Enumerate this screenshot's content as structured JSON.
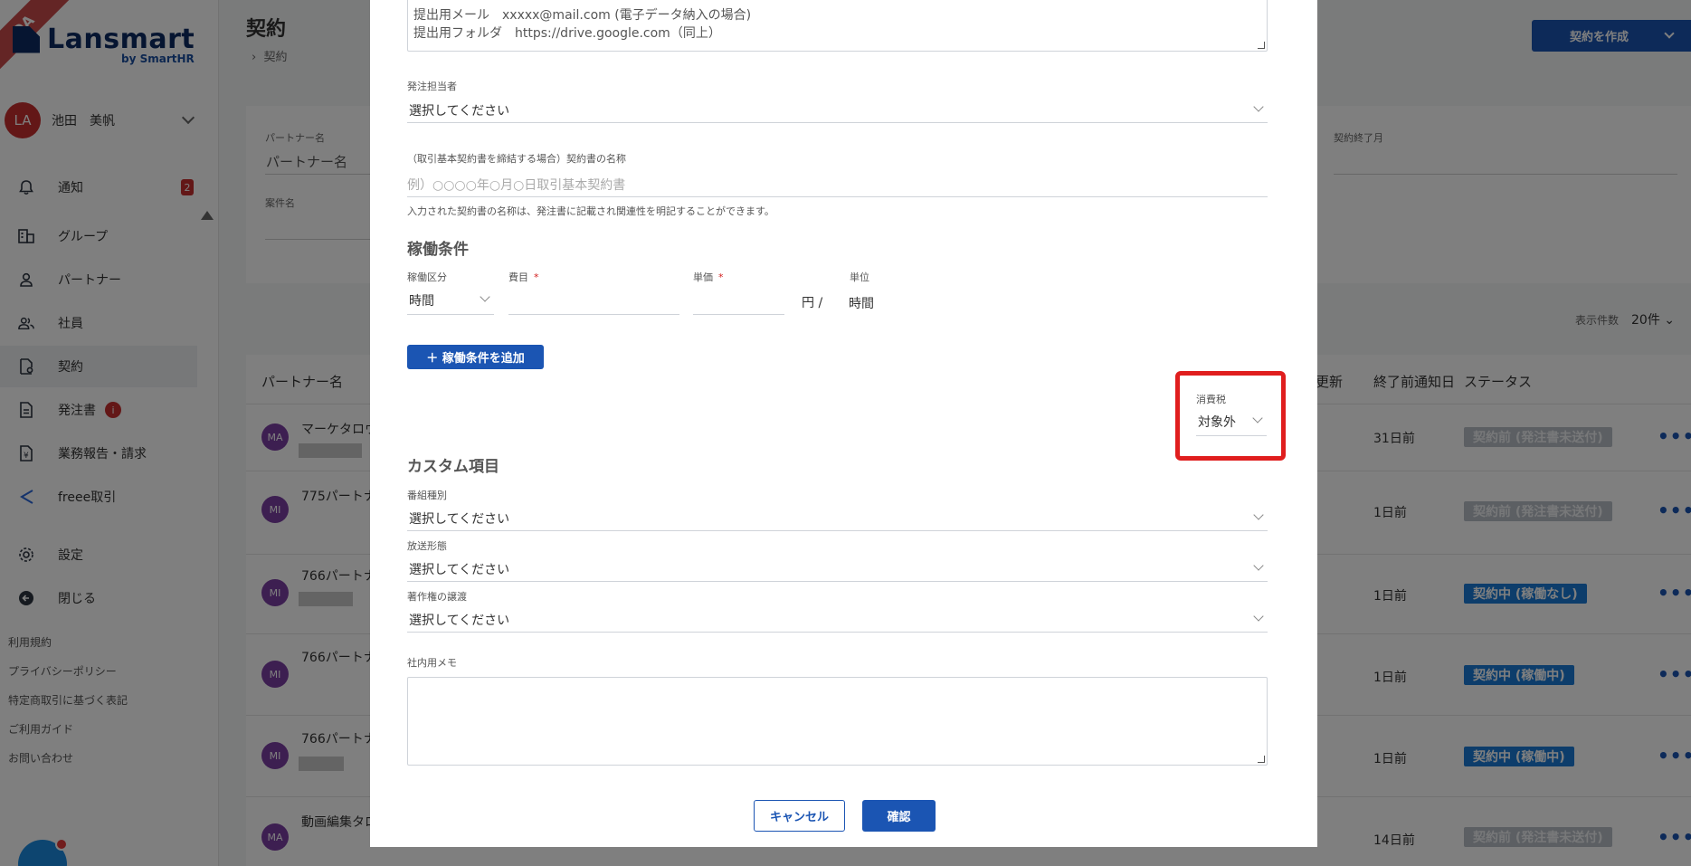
{
  "app": {
    "ribbon": "QA",
    "logo_text": "Lansmart",
    "logo_sub": "by SmartHR"
  },
  "user": {
    "initials": "LA",
    "name": "池田　美帆"
  },
  "nav": [
    {
      "label": "通知",
      "icon": "bell-icon",
      "badge": "2"
    },
    {
      "label": "グループ",
      "icon": "building-icon"
    },
    {
      "label": "パートナー",
      "icon": "person-icon"
    },
    {
      "label": "社員",
      "icon": "people-icon"
    },
    {
      "label": "契約",
      "icon": "contract-icon"
    },
    {
      "label": "発注書",
      "icon": "document-icon",
      "badge": "i"
    },
    {
      "label": "業務報告・請求",
      "icon": "invoice-icon"
    },
    {
      "label": "freee取引",
      "icon": "freee-icon"
    },
    {
      "label": "設定",
      "icon": "gear-icon"
    },
    {
      "label": "閉じる",
      "icon": "arrow-left-icon"
    }
  ],
  "footer_links": [
    "利用規約",
    "プライバシーポリシー",
    "特定商取引に基づく表記",
    "ご利用ガイド",
    "お問い合わせ"
  ],
  "page": {
    "title": "契約",
    "breadcrumb": "契約",
    "create_button": "契約を作成",
    "filters": {
      "partner_label": "パートナー名",
      "partner_placeholder": "パートナー名",
      "case_label": "案件名",
      "end_month_label": "契約終了月"
    },
    "per_page_label": "表示件数",
    "per_page_value": "20件",
    "table": {
      "headers": {
        "partner": "パートナー名",
        "renewal": "更新",
        "notice": "終了前通知日",
        "status": "ステータス"
      },
      "rows": [
        {
          "avatar": "MA",
          "name": "マーケタロウ",
          "days": "31日前",
          "status": "契約前 (発注書未送付)",
          "status_type": "grey"
        },
        {
          "avatar": "MI",
          "name": "775パートナ",
          "days": "1日前",
          "status": "契約前 (発注書未送付)",
          "status_type": "grey"
        },
        {
          "avatar": "MI",
          "name": "766パートナ",
          "days": "1日前",
          "status": "契約中 (稼働なし)",
          "status_type": "blue"
        },
        {
          "avatar": "MI",
          "name": "766パートナ",
          "days": "1日前",
          "status": "契約中 (稼働中)",
          "status_type": "blue"
        },
        {
          "avatar": "MI",
          "name": "766パートナ",
          "days": "1日前",
          "status": "契約中 (稼働中)",
          "status_type": "blue"
        },
        {
          "avatar": "MA",
          "name": "動画編集タロ",
          "days": "14日前",
          "status": "契約前 (発注書未送付)",
          "status_type": "grey"
        }
      ]
    }
  },
  "modal": {
    "top_textarea_lines": [
      "提出用メール　xxxxx@mail.com (電子データ納入の場合)",
      "提出用フォルダ　https://drive.google.com（同上）"
    ],
    "order_manager": {
      "label": "発注担当者",
      "value": "選択してください"
    },
    "contract_name": {
      "label": "（取引基本契約書を締結する場合）契約書の名称",
      "placeholder": "例）○○○○年○月○日取引基本契約書",
      "hint": "入力された契約書の名称は、発注書に記載され関連性を明記することができます。"
    },
    "work_conditions": {
      "title": "稼働条件",
      "type_label": "稼働区分",
      "type_value": "時間",
      "expense_label": "費目",
      "price_label": "単価",
      "yen_per": "円 /",
      "unit_label": "単位",
      "unit_value": "時間",
      "required_mark": "*",
      "add_button": "＋ 稼働条件を追加"
    },
    "tax": {
      "label": "消費税",
      "value": "対象外"
    },
    "custom": {
      "title": "カスタム項目",
      "fields": [
        {
          "label": "番組種別",
          "value": "選択してください"
        },
        {
          "label": "放送形態",
          "value": "選択してください"
        },
        {
          "label": "著作権の譲渡",
          "value": "選択してください"
        }
      ]
    },
    "memo_label": "社内用メモ",
    "cancel_button": "キャンセル",
    "confirm_button": "確認"
  }
}
